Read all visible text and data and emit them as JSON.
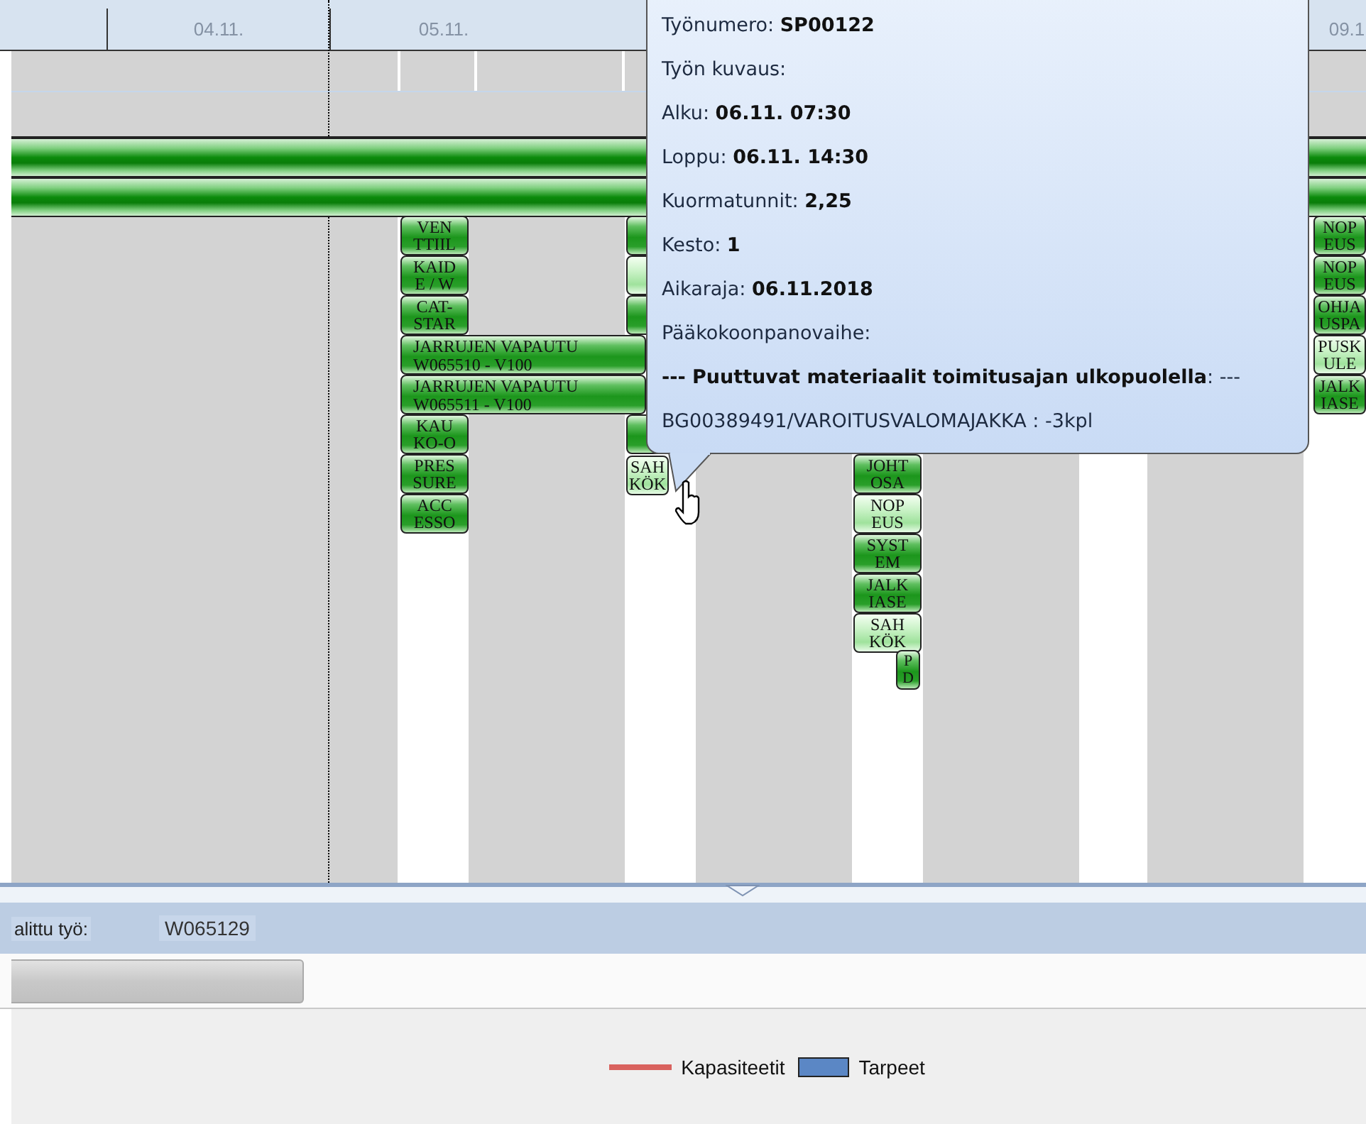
{
  "timeline": {
    "dates": [
      {
        "label": "04.11."
      },
      {
        "label": "05.11."
      },
      {
        "label": "09.1"
      }
    ]
  },
  "task_columns": [
    {
      "tasks": [
        {
          "label": "VEN\nTTIIL",
          "kind": "dark"
        },
        {
          "label": "KAID\nE / W",
          "kind": "dark"
        },
        {
          "label": "CAT-\nSTAR",
          "kind": "dark"
        },
        {
          "label": "JARRUJEN VAPAUTU\nW065510 - V100",
          "kind": "wide"
        },
        {
          "label": "JARRUJEN VAPAUTU\nW065511 - V100",
          "kind": "wide"
        },
        {
          "label": "KAU\nKO-O",
          "kind": "dark"
        },
        {
          "label": "PRES\nSURE",
          "kind": "dark"
        },
        {
          "label": "ACC\nESSO",
          "kind": "dark"
        }
      ]
    },
    {
      "tasks": [
        {
          "kind": "dark"
        },
        {
          "kind": "light"
        },
        {
          "kind": "dark"
        },
        {
          "kind": "gap"
        },
        {
          "kind": "gap"
        },
        {
          "kind": "dark"
        },
        {
          "label": "SAH\nKÖK",
          "kind": "light"
        }
      ]
    },
    {
      "tasks": [
        {
          "kind": "gap"
        },
        {
          "kind": "gap"
        },
        {
          "kind": "gap"
        },
        {
          "kind": "gap"
        },
        {
          "kind": "gap"
        },
        {
          "kind": "gap"
        },
        {
          "label": "JOHT\nOSA",
          "kind": "dark"
        },
        {
          "label": "NOP\nEUS",
          "kind": "light"
        },
        {
          "label": "SYST\nEM",
          "kind": "dark"
        },
        {
          "label": "JALK\nIASE",
          "kind": "dark"
        },
        {
          "label": "SAH\nKÖK",
          "kind": "light"
        },
        {
          "label": "P\nD",
          "kind": "narrow"
        }
      ]
    },
    {
      "tasks": [
        {
          "label": "NOP\nEUS",
          "kind": "dark"
        },
        {
          "label": "NOP\nEUS",
          "kind": "dark"
        },
        {
          "label": "OHJA\nUSPA",
          "kind": "dark"
        },
        {
          "label": "PUSK\nULE",
          "kind": "light"
        },
        {
          "label": "JALK\nIASE",
          "kind": "dark"
        }
      ]
    }
  ],
  "tooltip": {
    "lines": [
      "Työnumero: **SP00122**",
      "Työn kuvaus:",
      "Alku:   **06.11. 07:30**",
      "Loppu:  **06.11. 14:30**",
      "Kuormatunnit: **2,25**",
      "Kesto: **1**",
      "Aikaraja: **06.11.2018**",
      "Pääkokoonpanovaihe:",
      "**--- Puuttuvat materiaalit toimitusajan ulkopuolella**: ---",
      "BG00389491/VAROITUSVALOMAJAKKA : -3kpl"
    ]
  },
  "selected_work": {
    "label": "alittu työ:",
    "value": "W065129"
  },
  "legend": [
    {
      "label": "Kapasiteetit",
      "kind": "line",
      "color": "#d9625e"
    },
    {
      "label": "Tarpeet",
      "kind": "box",
      "color": "#5b87c5"
    }
  ]
}
